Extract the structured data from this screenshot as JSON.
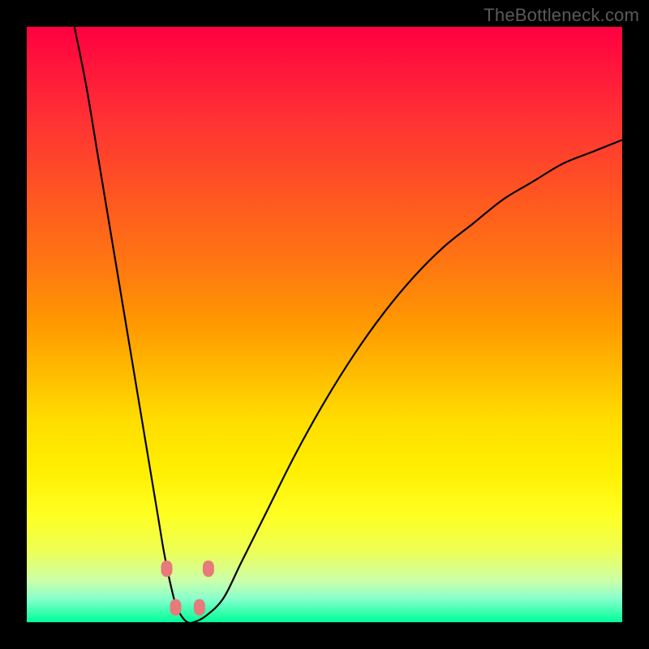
{
  "watermark": "TheBottleneck.com",
  "chart_data": {
    "type": "line",
    "title": "",
    "xlabel": "",
    "ylabel": "",
    "xlim": [
      0,
      100
    ],
    "ylim": [
      0,
      100
    ],
    "series": [
      {
        "name": "bottleneck-curve",
        "x": [
          8,
          10,
          12,
          14,
          16,
          18,
          20,
          22,
          23,
          24,
          25,
          26,
          27,
          28,
          30,
          33,
          36,
          40,
          45,
          50,
          55,
          60,
          65,
          70,
          75,
          80,
          85,
          90,
          95,
          100
        ],
        "y": [
          100,
          90,
          78,
          66,
          54,
          42,
          30,
          18,
          12,
          7,
          3,
          1,
          0,
          0,
          1,
          4,
          10,
          18,
          28,
          37,
          45,
          52,
          58,
          63,
          67,
          71,
          74,
          77,
          79,
          81
        ]
      }
    ],
    "markers": [
      {
        "x": 23.5,
        "y": 9
      },
      {
        "x": 30.5,
        "y": 9
      },
      {
        "x": 25.0,
        "y": 2.5
      },
      {
        "x": 29.0,
        "y": 2.5
      }
    ],
    "gradient_colors": {
      "top": "#ff0040",
      "mid": "#ffdd00",
      "bottom": "#00ff99"
    }
  }
}
